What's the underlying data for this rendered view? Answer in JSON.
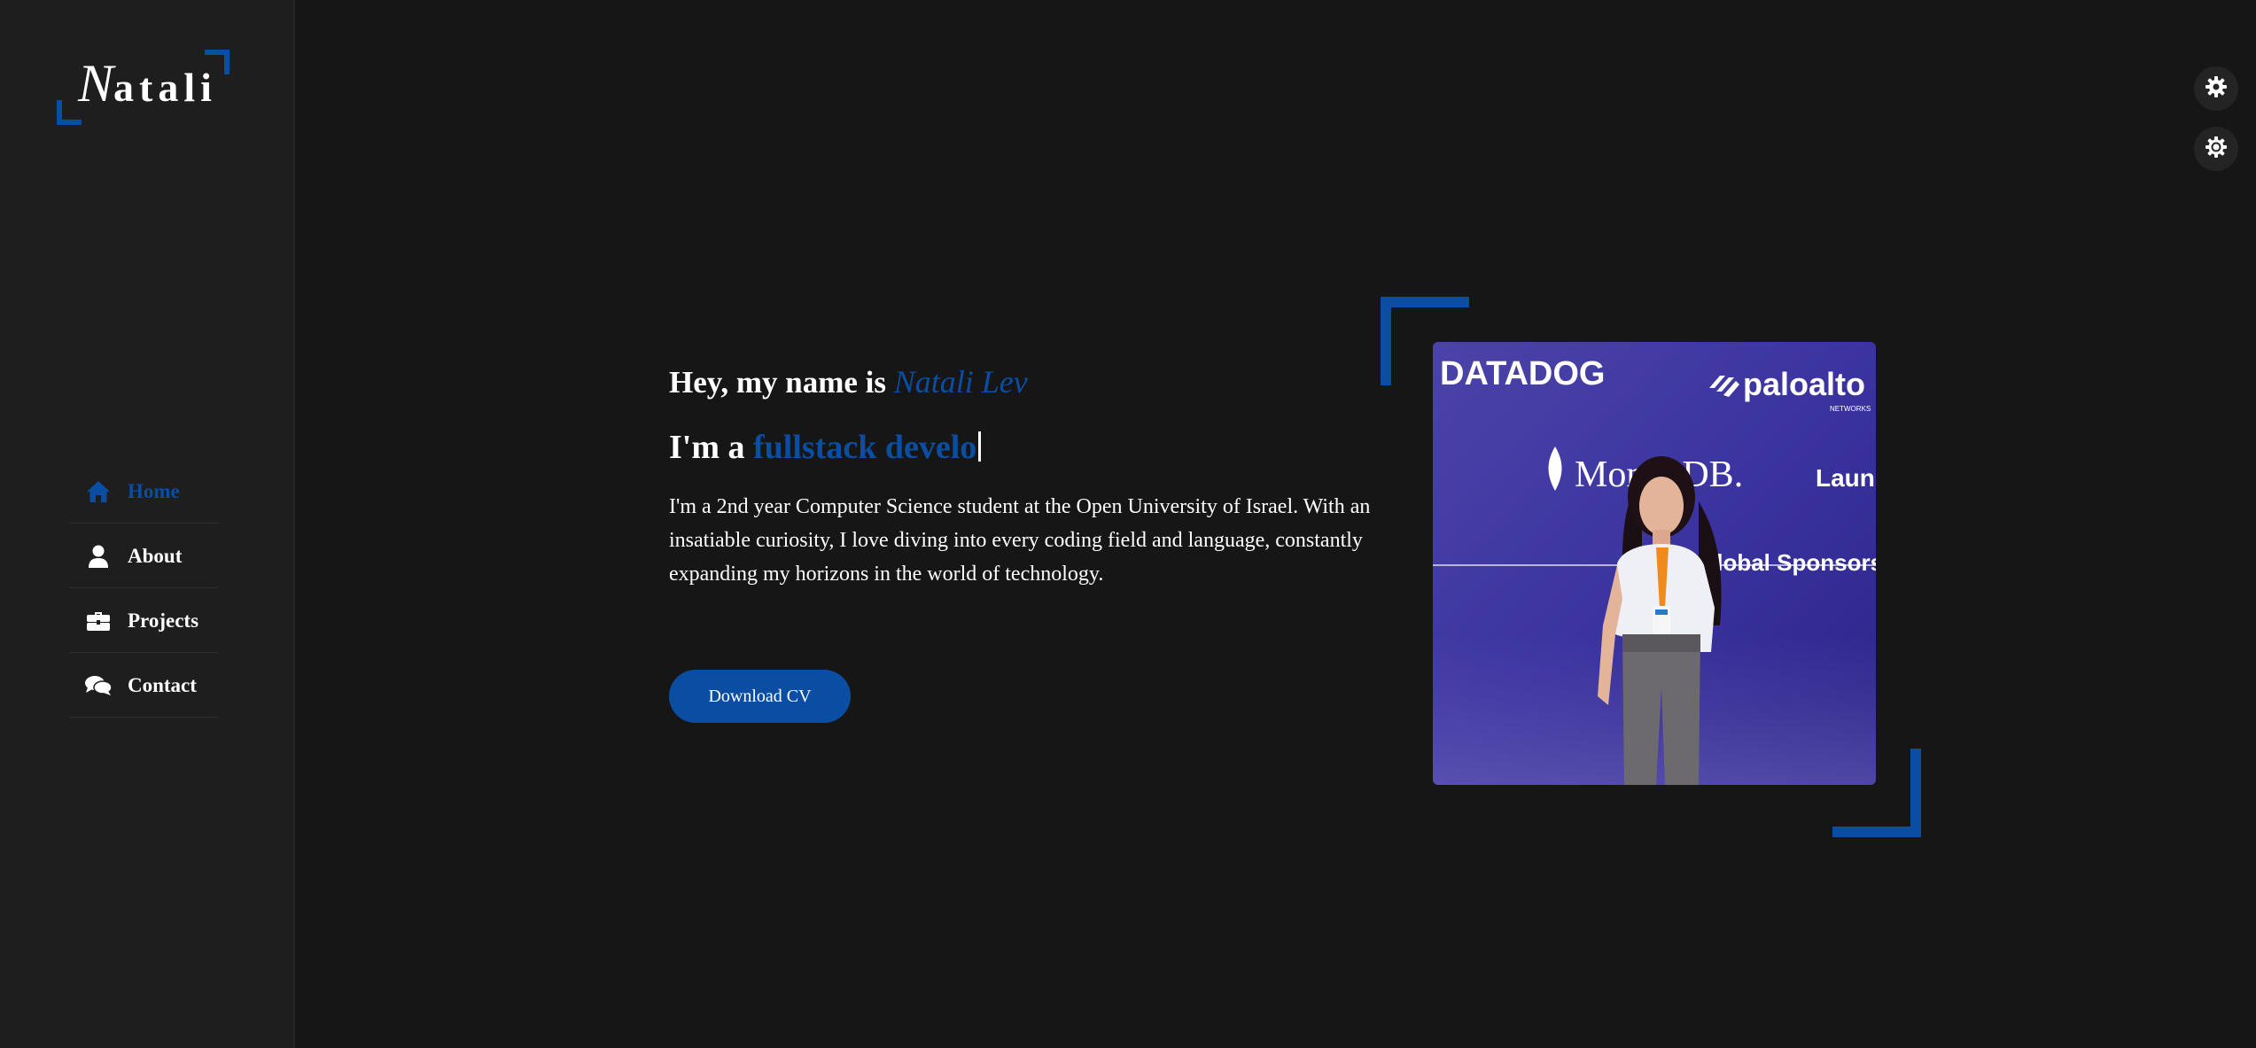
{
  "logo": {
    "initial": "N",
    "rest": "atali"
  },
  "nav": {
    "items": [
      {
        "label": "Home",
        "icon": "home-icon",
        "active": true
      },
      {
        "label": "About",
        "icon": "user-icon",
        "active": false
      },
      {
        "label": "Projects",
        "icon": "briefcase-icon",
        "active": false
      },
      {
        "label": "Contact",
        "icon": "chat-icon",
        "active": false
      }
    ]
  },
  "hero": {
    "greeting_prefix": "Hey, my name is",
    "name": "Natali Lev",
    "role_prefix": "I'm a",
    "role_typed": "fullstack develo",
    "bio": "I'm a 2nd year Computer Science student at the Open University of Israel. With an insatiable curiosity, I love diving into every coding field and language, constantly expanding my horizons in the world of technology.",
    "cv_button": "Download CV"
  },
  "photo": {
    "banner_texts": {
      "datadog": "DATADOG",
      "paloalto": "paloalto",
      "paloalto_sub": "NETWORKS",
      "mongodb": "MongoDB.",
      "launch": "Laun",
      "sponsors": "Global Sponsors"
    }
  },
  "colors": {
    "accent": "#0a4ea3",
    "background": "#161616",
    "sidebar": "#1e1e1e"
  }
}
